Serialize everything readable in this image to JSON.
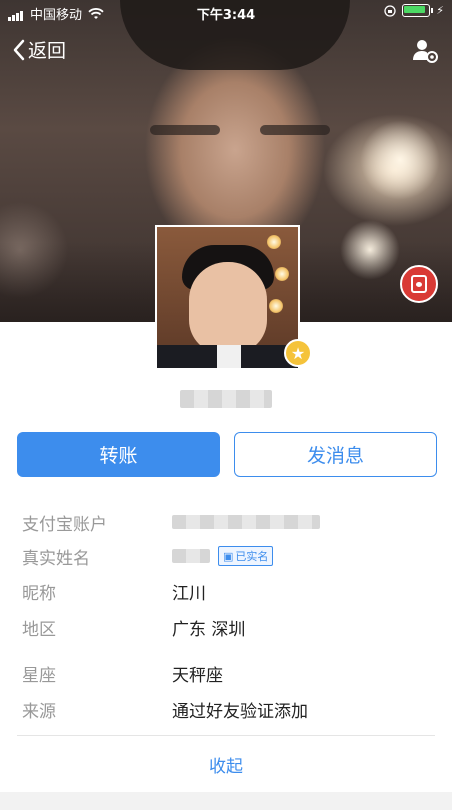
{
  "status_bar": {
    "carrier": "中国移动",
    "time": "下午3:44"
  },
  "nav": {
    "back_label": "返回",
    "settings_icon": "user-settings-icon"
  },
  "profile": {
    "nickname_blurred": true,
    "level_icon": "star-icon",
    "card_icon": "red-card-icon"
  },
  "actions": {
    "transfer_label": "转账",
    "message_label": "发消息"
  },
  "info_rows": {
    "account": {
      "label": "支付宝账户"
    },
    "real_name": {
      "label": "真实姓名",
      "verified_badge": "已实名"
    },
    "nickname": {
      "label": "昵称",
      "value": "江川"
    },
    "region": {
      "label": "地区",
      "value": "广东 深圳"
    },
    "zodiac": {
      "label": "星座",
      "value": "天秤座"
    },
    "source": {
      "label": "来源",
      "value": "通过好友验证添加"
    }
  },
  "collapse_label": "收起",
  "colors": {
    "accent": "#3d8ded",
    "badge_red": "#d93a35",
    "badge_gold": "#f5c33b"
  }
}
